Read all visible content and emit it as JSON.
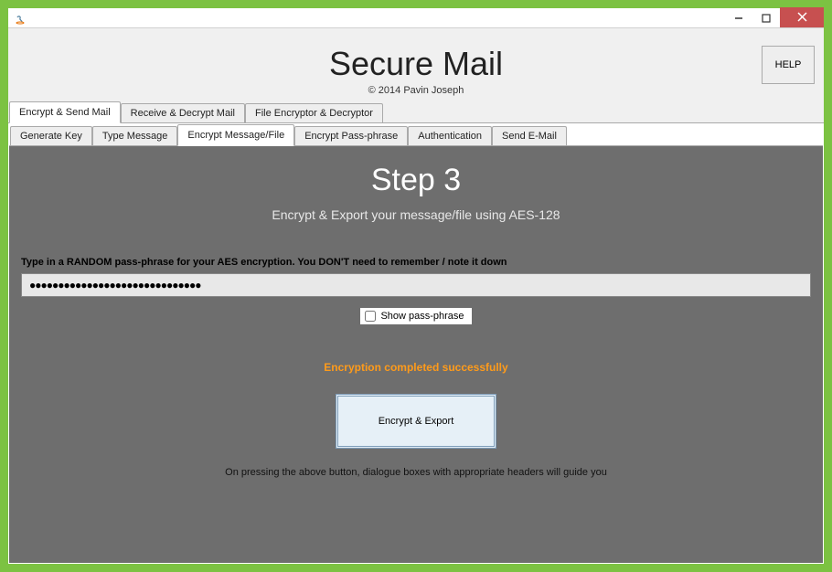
{
  "window": {
    "title": "",
    "minimize": "—",
    "maximize": "□",
    "close": "×"
  },
  "header": {
    "title": "Secure Mail",
    "copyright": "© 2014 Pavin Joseph",
    "help_label": "HELP"
  },
  "tabs_outer": [
    {
      "label": "Encrypt & Send Mail",
      "active": true
    },
    {
      "label": "Receive & Decrypt Mail",
      "active": false
    },
    {
      "label": "File Encryptor & Decryptor",
      "active": false
    }
  ],
  "tabs_inner": [
    {
      "label": "Generate Key",
      "active": false
    },
    {
      "label": "Type Message",
      "active": false
    },
    {
      "label": "Encrypt Message/File",
      "active": true
    },
    {
      "label": "Encrypt Pass-phrase",
      "active": false
    },
    {
      "label": "Authentication",
      "active": false
    },
    {
      "label": "Send E-Mail",
      "active": false
    }
  ],
  "content": {
    "step_title": "Step 3",
    "step_sub": "Encrypt & Export your message/file using AES-128",
    "instruction": "Type in a RANDOM pass-phrase for your AES encryption. You DON'T need to remember / note it down",
    "passphrase_masked": "●●●●●●●●●●●●●●●●●●●●●●●●●●●●●●",
    "show_passphrase_label": "Show pass-phrase",
    "show_passphrase_checked": false,
    "status": "Encryption completed successfully",
    "encrypt_button": "Encrypt & Export",
    "footnote": "On pressing the above button, dialogue boxes with appropriate headers will guide you"
  }
}
